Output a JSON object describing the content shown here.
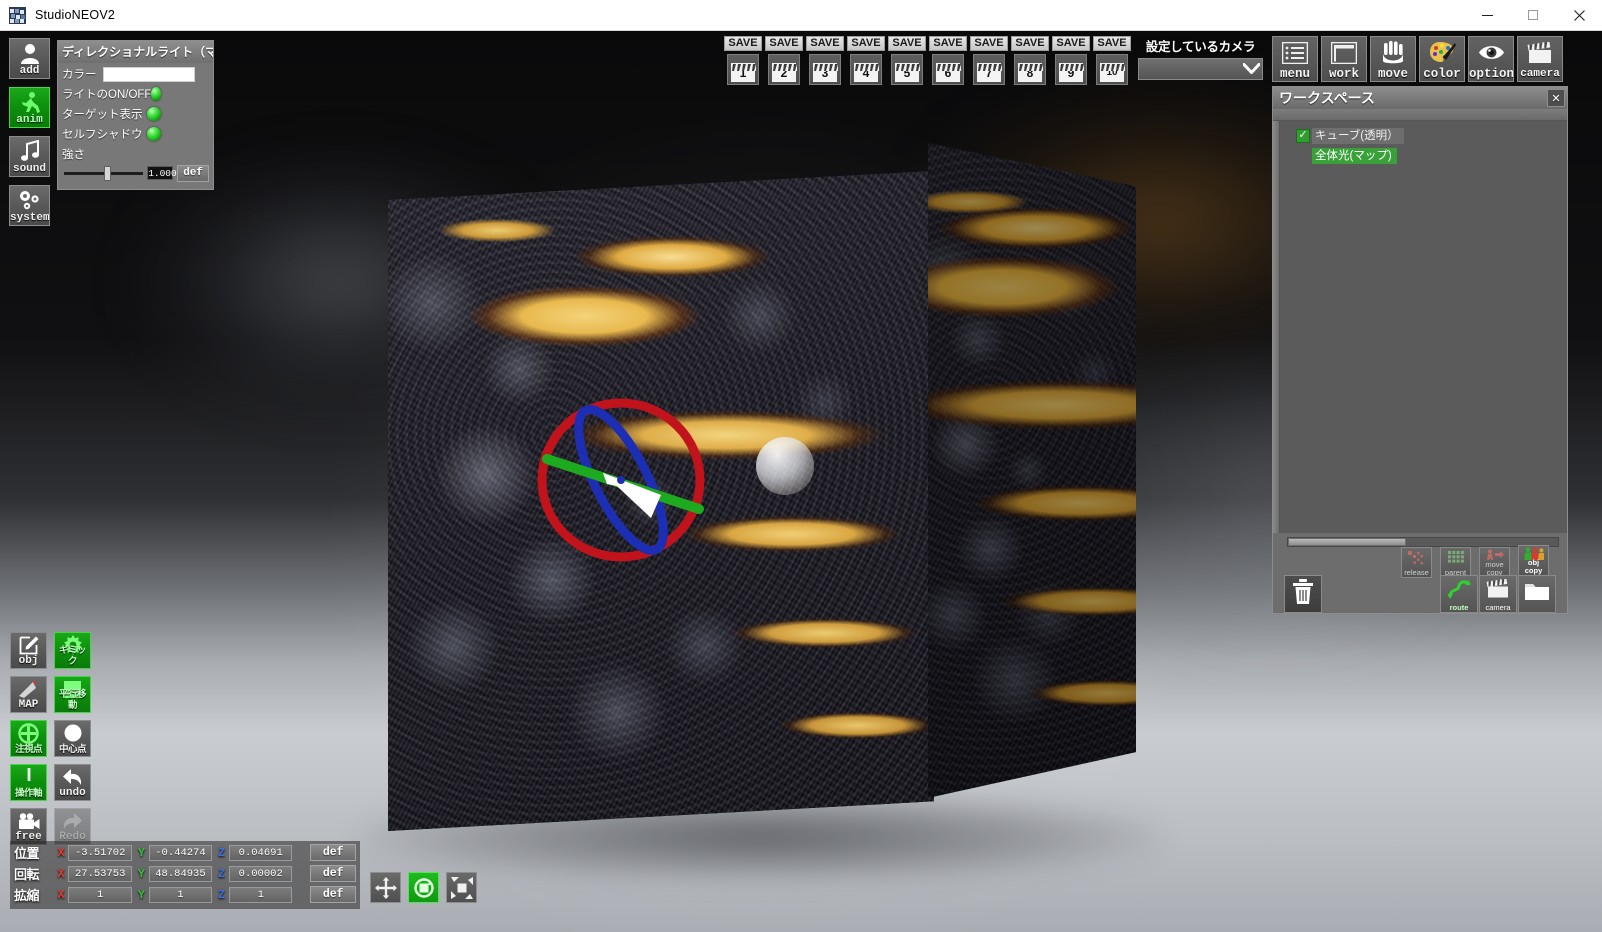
{
  "window": {
    "title": "StudioNEOV2",
    "app_icon": "app-icon",
    "controls": {
      "minimize": "—",
      "maximize": "□",
      "close": "✕"
    }
  },
  "left_tools": [
    {
      "id": "add",
      "label": "add",
      "icon": "person-add-icon",
      "active": false
    },
    {
      "id": "anim",
      "label": "anim",
      "icon": "running-person-icon",
      "active": true
    },
    {
      "id": "sound",
      "label": "sound",
      "icon": "music-note-icon",
      "active": false
    },
    {
      "id": "system",
      "label": "system",
      "icon": "gears-icon",
      "active": false
    }
  ],
  "light_panel": {
    "title": "ディレクショナルライト（マップ）",
    "color_label": "カラー",
    "color_value": "#ffffff",
    "rows": [
      {
        "label": "ライトのON/OFF",
        "state": "on"
      },
      {
        "label": "ターゲット表示",
        "state": "on"
      },
      {
        "label": "セルフシャドウ",
        "state": "on"
      }
    ],
    "strength_label": "強さ",
    "strength_value": "1.000",
    "default_button": "def"
  },
  "save_slots": [
    {
      "label": "SAVE",
      "number": "1"
    },
    {
      "label": "SAVE",
      "number": "2"
    },
    {
      "label": "SAVE",
      "number": "3"
    },
    {
      "label": "SAVE",
      "number": "4"
    },
    {
      "label": "SAVE",
      "number": "5"
    },
    {
      "label": "SAVE",
      "number": "6"
    },
    {
      "label": "SAVE",
      "number": "7"
    },
    {
      "label": "SAVE",
      "number": "8"
    },
    {
      "label": "SAVE",
      "number": "9"
    },
    {
      "label": "SAVE",
      "number": "10"
    }
  ],
  "camera_selector": {
    "label": "設定しているカメラ",
    "value": "",
    "chevron": "▼"
  },
  "top_tools": [
    {
      "id": "menu",
      "label": "menu",
      "icon": "list-menu-icon"
    },
    {
      "id": "work",
      "label": "work",
      "icon": "workspace-frame-icon"
    },
    {
      "id": "move",
      "label": "move",
      "icon": "hand-icon"
    },
    {
      "id": "color",
      "label": "color",
      "icon": "palette-icon"
    },
    {
      "id": "option",
      "label": "option",
      "icon": "eye-icon"
    },
    {
      "id": "camera",
      "label": "camera",
      "icon": "clapperboard-icon"
    }
  ],
  "workspace": {
    "title": "ワークスペース",
    "close": "✕",
    "items": [
      {
        "name": "キューブ(透明）",
        "checked": true,
        "selected": true,
        "highlight": false
      },
      {
        "name": "全体光(マップ)",
        "checked": false,
        "selected": false,
        "highlight": true
      }
    ],
    "buttons": [
      {
        "id": "release",
        "label": "release",
        "label2": "",
        "icon": "release-icon"
      },
      {
        "id": "parent",
        "label": "parent",
        "label2": "",
        "icon": "grid-parent-icon"
      },
      {
        "id": "move-copy",
        "label": "move",
        "label2": "copy",
        "icon": "move-copy-icon"
      },
      {
        "id": "obj-copy",
        "label": "obj",
        "label2": "copy",
        "icon": "obj-copy-icon"
      },
      {
        "id": "trash",
        "label": "",
        "label2": "",
        "icon": "trash-icon"
      },
      {
        "id": "route",
        "label": "route",
        "label2": "",
        "icon": "route-icon"
      },
      {
        "id": "camera",
        "label": "camera",
        "label2": "",
        "icon": "clapperboard-icon"
      },
      {
        "id": "folder",
        "label": "",
        "label2": "",
        "icon": "folder-icon"
      }
    ]
  },
  "object_tools": [
    {
      "id": "obj",
      "label": "obj",
      "jp": false,
      "icon": "object-edit-icon",
      "active": false
    },
    {
      "id": "gimmick",
      "label": "ギミック",
      "jp": true,
      "icon": "gear-icon",
      "active": true
    },
    {
      "id": "map",
      "label": "MAP",
      "jp": false,
      "icon": "map-pin-icon",
      "active": false
    },
    {
      "id": "translate",
      "label": "平行移動",
      "jp": true,
      "icon": "square-icon",
      "active": true
    },
    {
      "id": "focus",
      "label": "注視点",
      "jp": true,
      "icon": "crosshair-icon",
      "active": true
    },
    {
      "id": "center",
      "label": "中心点",
      "jp": true,
      "icon": "circle-icon",
      "active": false
    },
    {
      "id": "axis",
      "label": "操作軸",
      "jp": true,
      "icon": "axis-icon",
      "active": true
    },
    {
      "id": "undo",
      "label": "undo",
      "jp": false,
      "icon": "undo-arrow-icon",
      "active": false
    },
    {
      "id": "free",
      "label": "free",
      "jp": false,
      "icon": "movie-camera-icon",
      "active": false
    },
    {
      "id": "redo",
      "label": "Redo",
      "jp": false,
      "icon": "redo-arrow-icon",
      "active": false,
      "disabled": true
    }
  ],
  "transform": {
    "rows": [
      {
        "label": "位置",
        "axes": [
          {
            "axis": "X",
            "value": "-3.51702"
          },
          {
            "axis": "Y",
            "value": "-0.44274"
          },
          {
            "axis": "Z",
            "value": "0.04691"
          }
        ],
        "default_button": "def"
      },
      {
        "label": "回転",
        "axes": [
          {
            "axis": "X",
            "value": "27.53753"
          },
          {
            "axis": "Y",
            "value": "48.84935"
          },
          {
            "axis": "Z",
            "value": "0.00002"
          }
        ],
        "default_button": "def"
      },
      {
        "label": "拡縮",
        "axes": [
          {
            "axis": "X",
            "value": "1"
          },
          {
            "axis": "Y",
            "value": "1"
          },
          {
            "axis": "Z",
            "value": "1"
          }
        ],
        "default_button": "def"
      }
    ]
  },
  "gizmo_modes": [
    {
      "id": "translate",
      "icon": "four-arrows-icon",
      "active": false
    },
    {
      "id": "rotate",
      "icon": "rotate-icon",
      "active": true
    },
    {
      "id": "scale",
      "icon": "scale-icon",
      "active": false
    }
  ],
  "viewport": {
    "gizmo": {
      "type": "rotation-gizmo",
      "ring_color": "#c0131b",
      "axis_green": "#1eaa1e",
      "axis_blue": "#1c2fb4",
      "pointer_color": "#ffffff"
    },
    "object": "textured-cube-lava",
    "light_target": "light-target-sphere"
  },
  "colors": {
    "accent_green": "#1aa81a",
    "panel_gray": "#6d6d6d",
    "axis_x": "#e23b2e",
    "axis_y": "#34c034",
    "axis_z": "#3a6fe0"
  }
}
